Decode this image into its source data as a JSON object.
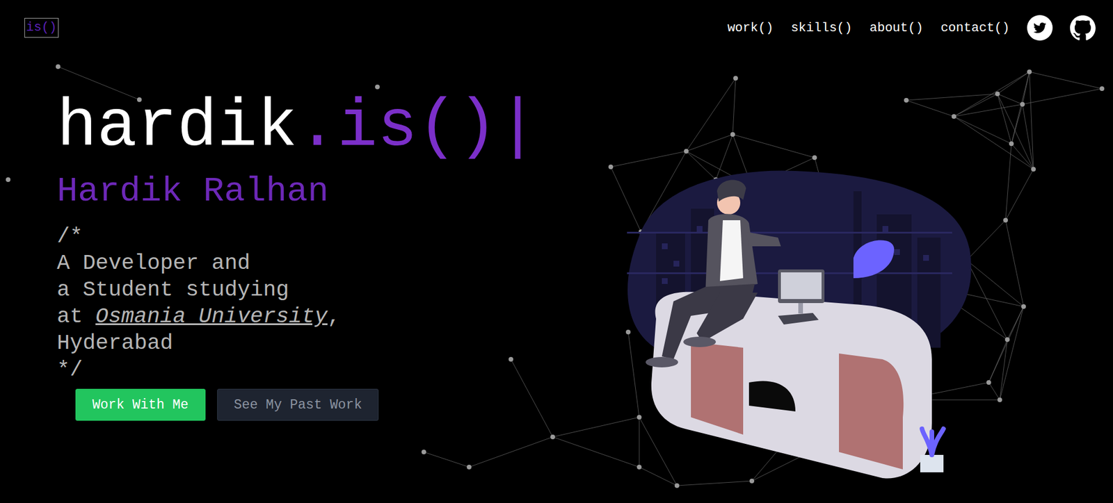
{
  "nav": {
    "logo": "is()",
    "links": [
      "work()",
      "skills()",
      "about()",
      "contact()"
    ]
  },
  "hero": {
    "title": {
      "name": "hardik",
      "suffix": ".is()",
      "cursor": "|"
    },
    "subtitle": "Hardik Ralhan",
    "bio": {
      "open": "/*",
      "lines": [
        "A Developer and",
        "a Student studying"
      ],
      "at": "at",
      "university": "Osmania University",
      "comma": ",",
      "city": "Hyderabad",
      "close": "*/"
    }
  },
  "buttons": [
    {
      "label": "Work With Me",
      "kind": "primary"
    },
    {
      "label": "See My Past Work",
      "kind": "secondary"
    }
  ]
}
